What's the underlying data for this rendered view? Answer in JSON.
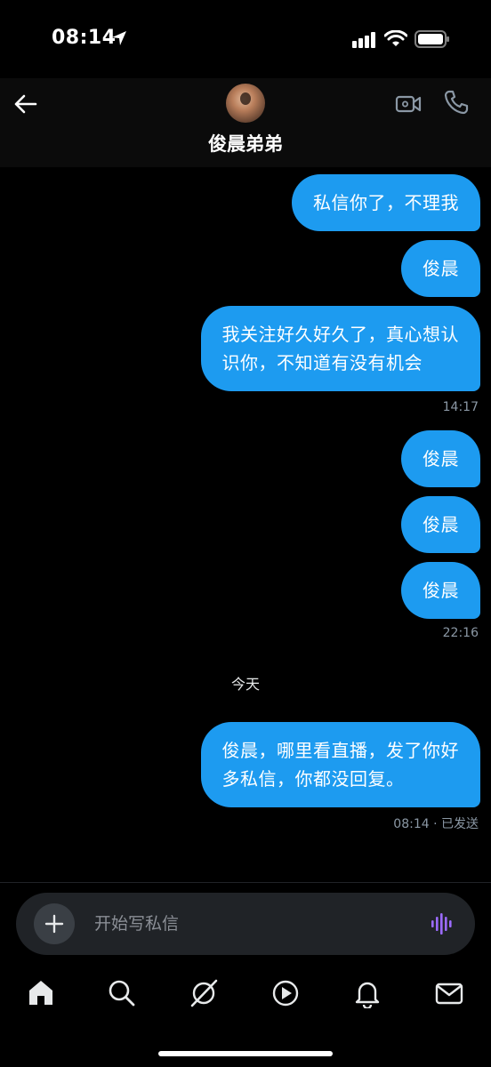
{
  "status_bar": {
    "time": "08:14",
    "icons": [
      "location-arrow-icon",
      "signal-bars-icon",
      "wifi-icon",
      "battery-icon"
    ]
  },
  "header": {
    "contact_name": "俊晨弟弟",
    "icons": [
      "back-arrow-icon",
      "avatar",
      "video-call-icon",
      "phone-call-icon"
    ]
  },
  "messages": [
    {
      "text": "私信你了，不理我"
    },
    {
      "text": "俊晨"
    },
    {
      "text": "我关注好久好久了，真心想认\n识你，不知道有没有机会"
    },
    {
      "text": "俊晨"
    },
    {
      "text": "俊晨"
    },
    {
      "text": "俊晨"
    },
    {
      "text": "俊晨，哪里看直播，发了你好\n多私信，你都没回复。"
    }
  ],
  "timestamps": [
    "14:17",
    "22:16",
    "08:14 · 已发送"
  ],
  "day_divider": "今天",
  "composer": {
    "placeholder": "开始写私信",
    "value": ""
  },
  "tab_bar": {
    "items": [
      "home-icon",
      "search-icon",
      "grok-icon",
      "video-icon",
      "notifications-icon",
      "messages-icon"
    ]
  },
  "colors": {
    "bubble": "#1d9bf0",
    "background": "#000000",
    "composer_bg": "#202327",
    "voice_accent": "#9b6bff"
  }
}
